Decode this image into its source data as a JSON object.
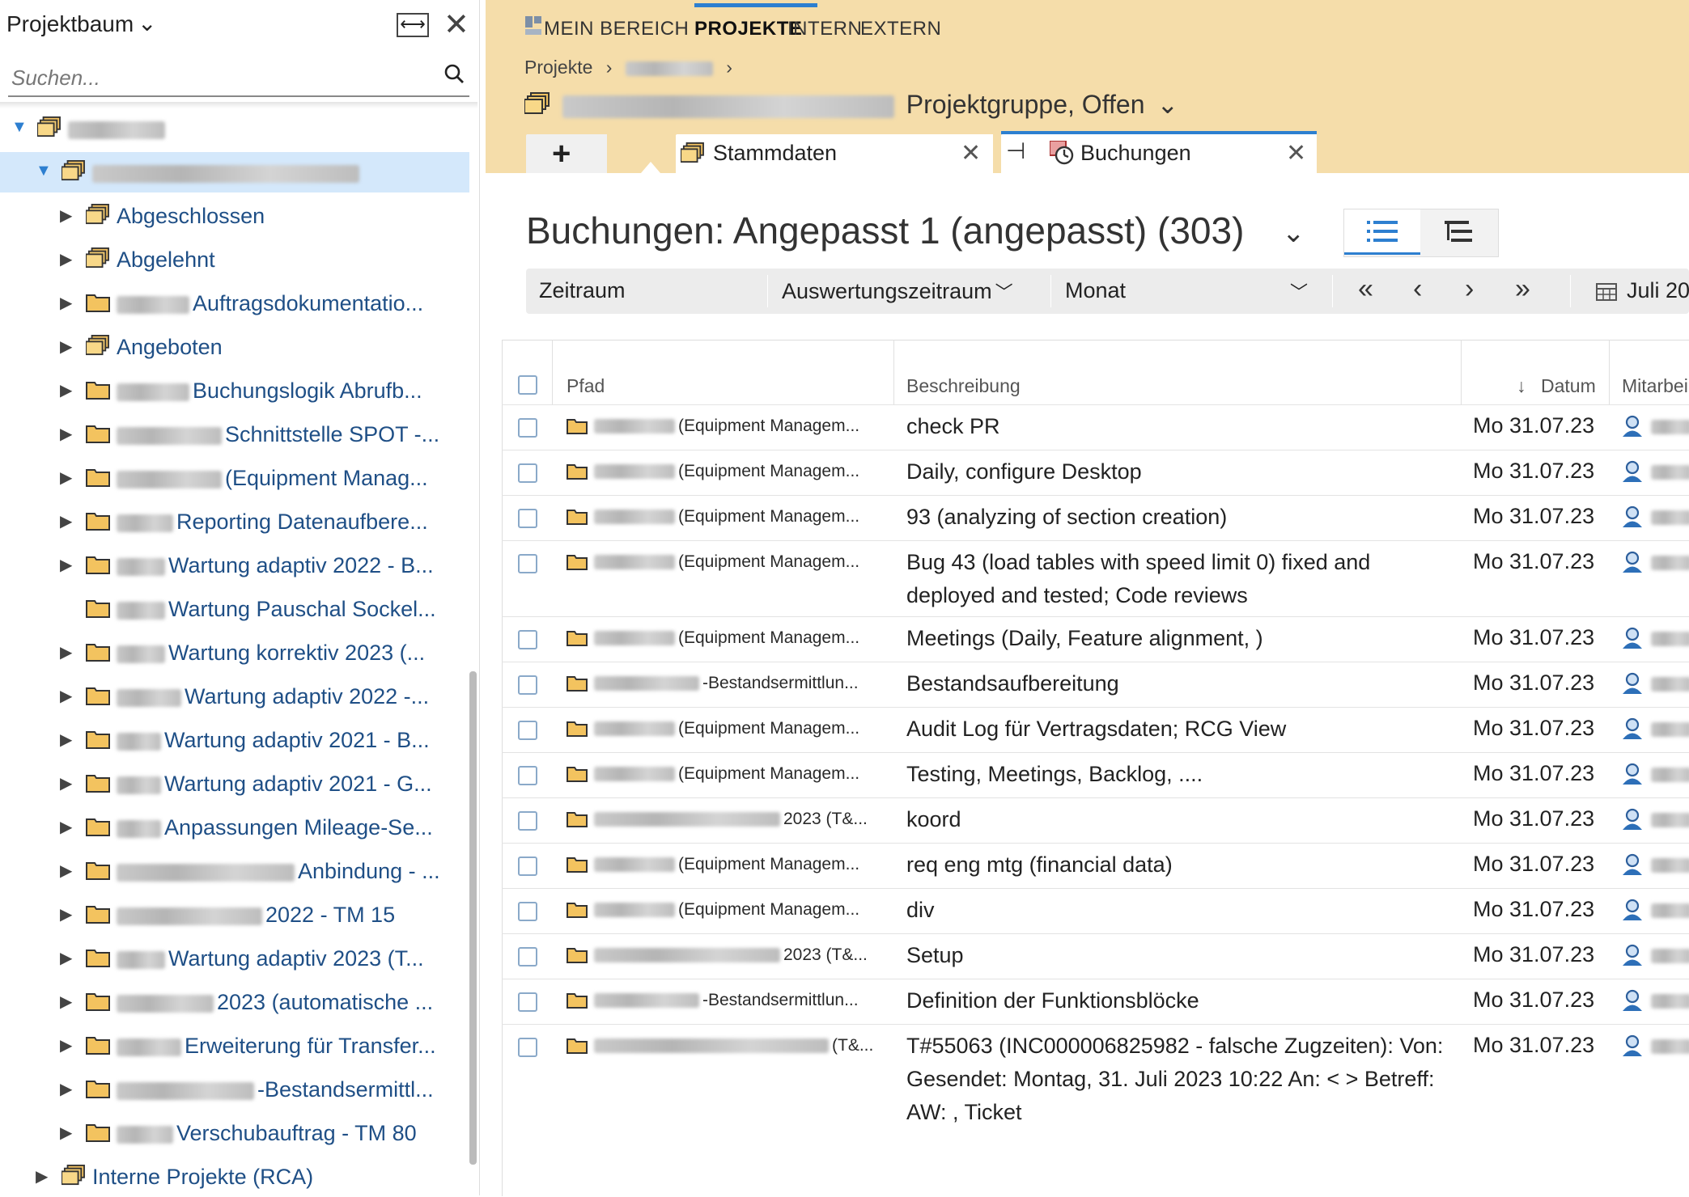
{
  "left_panel": {
    "title": "Projektbaum",
    "search_placeholder": "Suchen...",
    "tree": [
      {
        "label": "",
        "type": "group",
        "expanded": true
      },
      {
        "label": "",
        "type": "group",
        "expanded": true,
        "selected": true
      },
      {
        "label": "Abgeschlossen",
        "type": "group"
      },
      {
        "label": "Abgelehnt",
        "type": "group"
      },
      {
        "label": "Auftragsdokumentatio...",
        "type": "folder"
      },
      {
        "label": "Angeboten",
        "type": "group"
      },
      {
        "label": "Buchungslogik Abrufb...",
        "type": "folder"
      },
      {
        "label": "Schnittstelle SPOT -...",
        "type": "folder"
      },
      {
        "label": "(Equipment Manag...",
        "type": "folder"
      },
      {
        "label": "Reporting Datenaufbere...",
        "type": "folder"
      },
      {
        "label": "Wartung adaptiv 2022 - B...",
        "type": "folder"
      },
      {
        "label": "Wartung Pauschal Sockel...",
        "type": "folder",
        "no_arrow": true
      },
      {
        "label": "Wartung korrektiv 2023 (...",
        "type": "folder"
      },
      {
        "label": "Wartung adaptiv 2022 -...",
        "type": "folder"
      },
      {
        "label": "Wartung adaptiv 2021 - B...",
        "type": "folder"
      },
      {
        "label": "Wartung adaptiv 2021 - G...",
        "type": "folder"
      },
      {
        "label": "Anpassungen Mileage-Se...",
        "type": "folder"
      },
      {
        "label": "Anbindung - ...",
        "type": "folder"
      },
      {
        "label": "2022 - TM 15",
        "type": "folder"
      },
      {
        "label": "Wartung adaptiv 2023 (T...",
        "type": "folder"
      },
      {
        "label": "2023 (automatische ...",
        "type": "folder"
      },
      {
        "label": "Erweiterung für Transfer...",
        "type": "folder"
      },
      {
        "label": "-Bestandsermittl...",
        "type": "folder"
      },
      {
        "label": "Verschubauftrag - TM 80",
        "type": "folder"
      },
      {
        "label": "Interne Projekte (RCA)",
        "type": "group"
      }
    ]
  },
  "topnav": {
    "tabs": [
      {
        "label": "MEIN BEREICH"
      },
      {
        "label": "PROJEKTE",
        "active": true
      },
      {
        "label": "INTERN"
      },
      {
        "label": "EXTERN"
      }
    ],
    "breadcrumb_root": "Projekte",
    "breadcrumb_sep": "›",
    "group_status": "Projektgruppe, Offen"
  },
  "window_tabs": {
    "add": "+",
    "tabs": [
      {
        "label": "Stammdaten"
      },
      {
        "label": "Buchungen",
        "active": true
      }
    ]
  },
  "view": {
    "title": "Buchungen: Angepasst 1 (angepasst) (303)"
  },
  "filterbar": {
    "zeitraum": "Zeitraum",
    "auswertungszeitraum": "Auswertungszeitraum",
    "monat": "Monat",
    "period": "Juli 20"
  },
  "table": {
    "headers": {
      "pfad": "Pfad",
      "beschreibung": "Beschreibung",
      "datum": "Datum",
      "mitarbeiter": "Mitarbei"
    },
    "rows": [
      {
        "path": "(Equipment Managem...",
        "desc": "check PR",
        "date": "Mo 31.07.23"
      },
      {
        "path": "(Equipment Managem...",
        "desc": "Daily, configure        Desktop",
        "date": "Mo 31.07.23"
      },
      {
        "path": "(Equipment Managem...",
        "desc": "93 (analyzing of section creation)",
        "date": "Mo 31.07.23"
      },
      {
        "path": "(Equipment Managem...",
        "desc": "Bug           43 (load tables with speed limit 0) fixed and deployed and tested; Code reviews",
        "date": "Mo 31.07.23"
      },
      {
        "path": "(Equipment Managem...",
        "desc": "Meetings (Daily, Feature alignment, )",
        "date": "Mo 31.07.23"
      },
      {
        "path": "-Bestandsermittlun...",
        "desc": "Bestandsaufbereitung",
        "date": "Mo 31.07.23"
      },
      {
        "path": "(Equipment Managem...",
        "desc": "Audit Log für Vertragsdaten; RCG View",
        "date": "Mo 31.07.23"
      },
      {
        "path": "(Equipment Managem...",
        "desc": "Testing, Meetings, Backlog, ....",
        "date": "Mo 31.07.23"
      },
      {
        "path": "2023 (T&...",
        "desc": "koord",
        "date": "Mo 31.07.23"
      },
      {
        "path": "(Equipment Managem...",
        "desc": "req eng mtg (financial data)",
        "date": "Mo 31.07.23"
      },
      {
        "path": "(Equipment Managem...",
        "desc": "div",
        "date": "Mo 31.07.23"
      },
      {
        "path": "2023 (T&...",
        "desc": "Setup",
        "date": "Mo 31.07.23"
      },
      {
        "path": "-Bestandsermittlun...",
        "desc": "Definition der Funktionsblöcke",
        "date": "Mo 31.07.23"
      },
      {
        "path": "(T&...",
        "desc": "T#55063 (INC000006825982 - falsche Zugzeiten): Von:              Gesendet: Montag, 31. Juli 2023 10:22 An:                                   <                                    > Betreff: AW:                                    ,  Ticket",
        "date": "Mo 31.07.23"
      }
    ]
  },
  "colors": {
    "accent": "#2d7fd0",
    "topbar": "#f5ddaa",
    "link": "#1f4f86",
    "selected": "#d4e8fb"
  }
}
